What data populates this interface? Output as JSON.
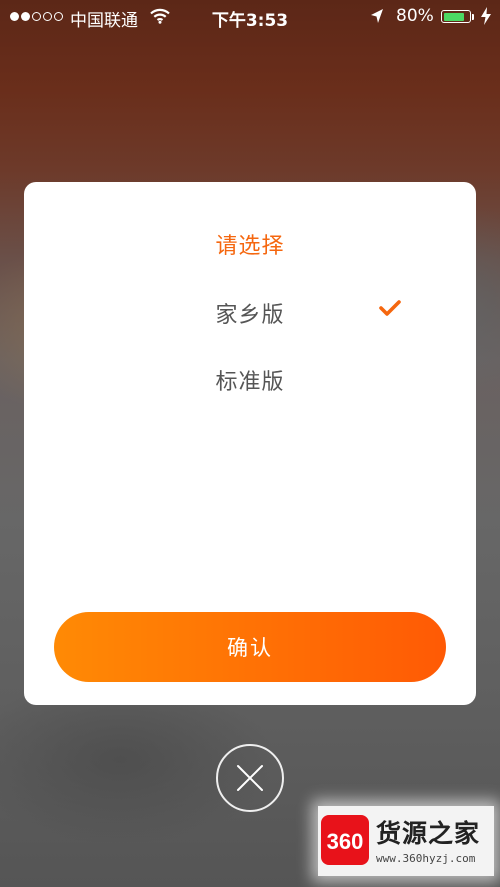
{
  "status_bar": {
    "carrier": "中国联通",
    "time": "下午3:53",
    "battery_percent": "80%",
    "battery_level": 0.8,
    "signal_bars_filled": 2,
    "signal_bars_total": 5
  },
  "dialog": {
    "title": "请选择",
    "options": [
      {
        "label": "家乡版",
        "selected": true
      },
      {
        "label": "标准版",
        "selected": false
      }
    ],
    "confirm_label": "确认"
  },
  "icons": {
    "close": "close-icon",
    "check": "checkmark-icon",
    "wifi": "wifi-icon",
    "location": "location-arrow-icon",
    "charging": "charging-bolt-icon"
  },
  "colors": {
    "accent": "#f5670f",
    "button_start": "#ff8a05",
    "button_end": "#ff5a05",
    "battery": "#4cd964"
  },
  "watermark": {
    "logo_text": "360",
    "name": "货源之家",
    "url": "www.360hyzj.com"
  }
}
